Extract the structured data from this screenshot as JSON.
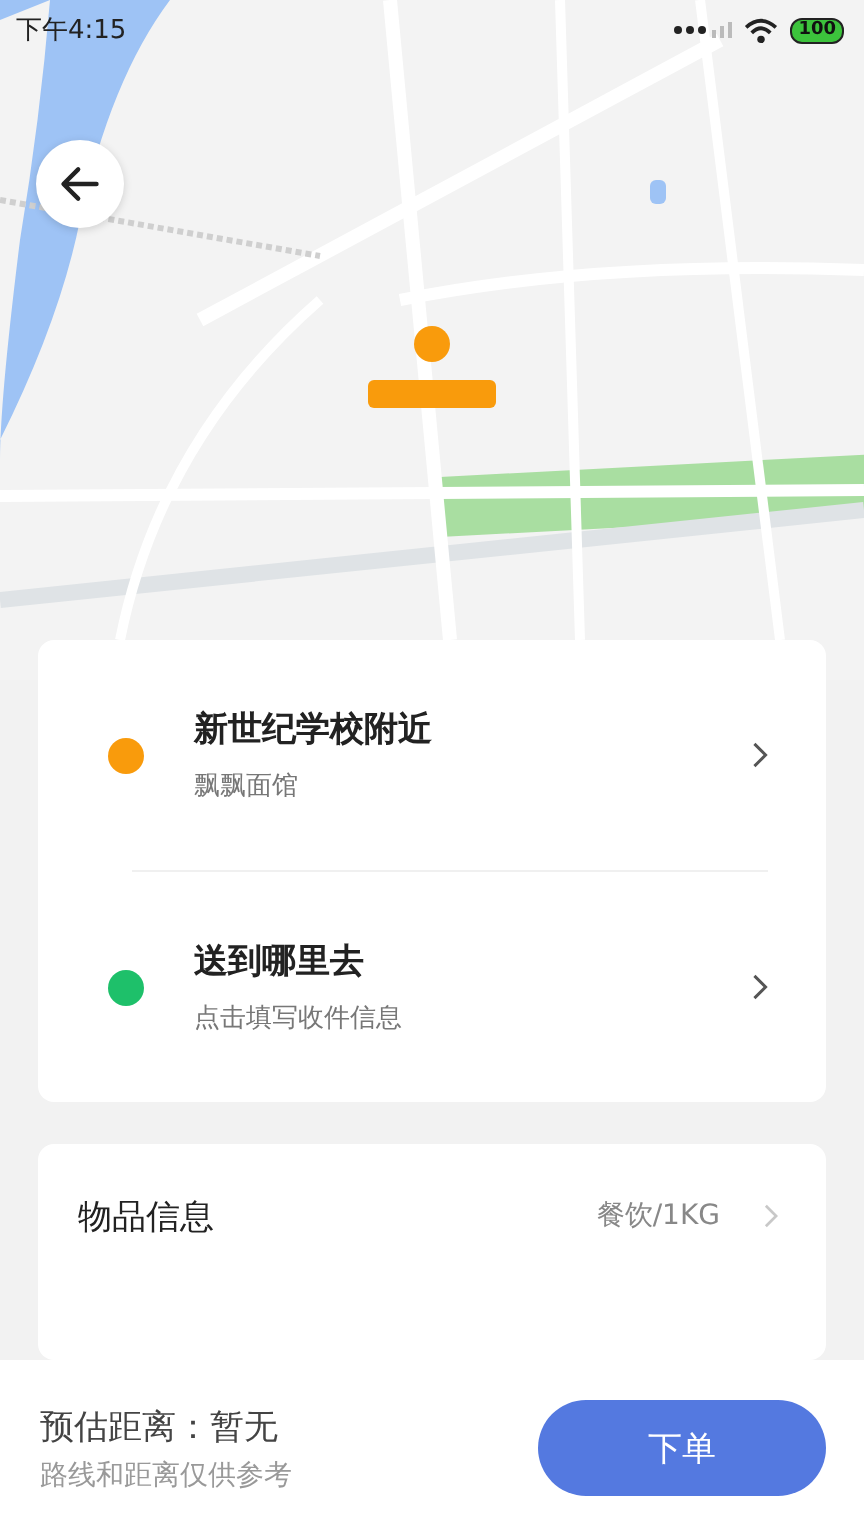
{
  "status_bar": {
    "time": "下午4:15",
    "battery": "100"
  },
  "route": [
    {
      "title": "新世纪学校附近",
      "subtitle": "飘飘面馆",
      "color": "#f99b0c"
    },
    {
      "title": "送到哪里去",
      "subtitle": "点击填写收件信息",
      "color": "#1ec06a"
    }
  ],
  "details": [
    {
      "label": "物品信息",
      "value": "餐饮/1KG"
    }
  ],
  "footer": {
    "estimate": "预估距离：暂无",
    "note": "路线和距离仅供参考",
    "button": "下单"
  }
}
